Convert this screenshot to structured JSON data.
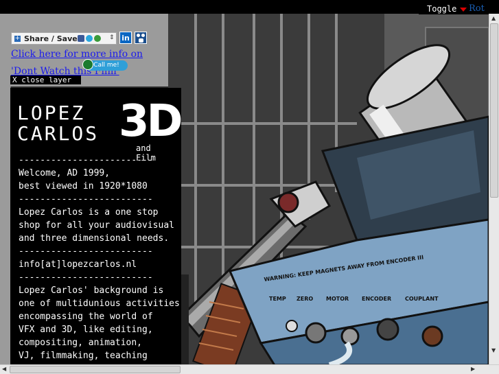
{
  "toggle": {
    "label": "Toggle",
    "rot_text": "Rot"
  },
  "share": {
    "label": "Share / Save",
    "arrows": "⇕"
  },
  "linkedin": {
    "label": "in"
  },
  "info_link": {
    "text": "Click here for more info on 'Dont Watch this Film'"
  },
  "call_me": {
    "label": "Call me!"
  },
  "close_layer": {
    "label": "X close layer"
  },
  "logo": {
    "line1": "LOPEZ",
    "line2": "CARLOS",
    "big": "3D",
    "sub": "and Film"
  },
  "panel": {
    "text": "-------------------------\nWelcome, AD 1999,\nbest viewed in 1920*1080\n-------------------------\nLopez Carlos is a one stop\nshop for all your audiovisual\nand three dimensional needs.\n-------------------------\ninfo[at]lopezcarlos.nl\n-------------------------\nLopez Carlos' background is\none of multidunious activities\nencompassing the world of\nVFX and 3D, like editing,\ncompositing, animation,\nVJ, filmmaking, teaching"
  },
  "scene": {
    "warning_text": "WARNING: KEEP MAGNETS AWAY FROM ENCODER III",
    "labels": [
      "TEMP",
      "ZERO",
      "MOTOR",
      "ENCODER",
      "COUPLANT"
    ]
  }
}
